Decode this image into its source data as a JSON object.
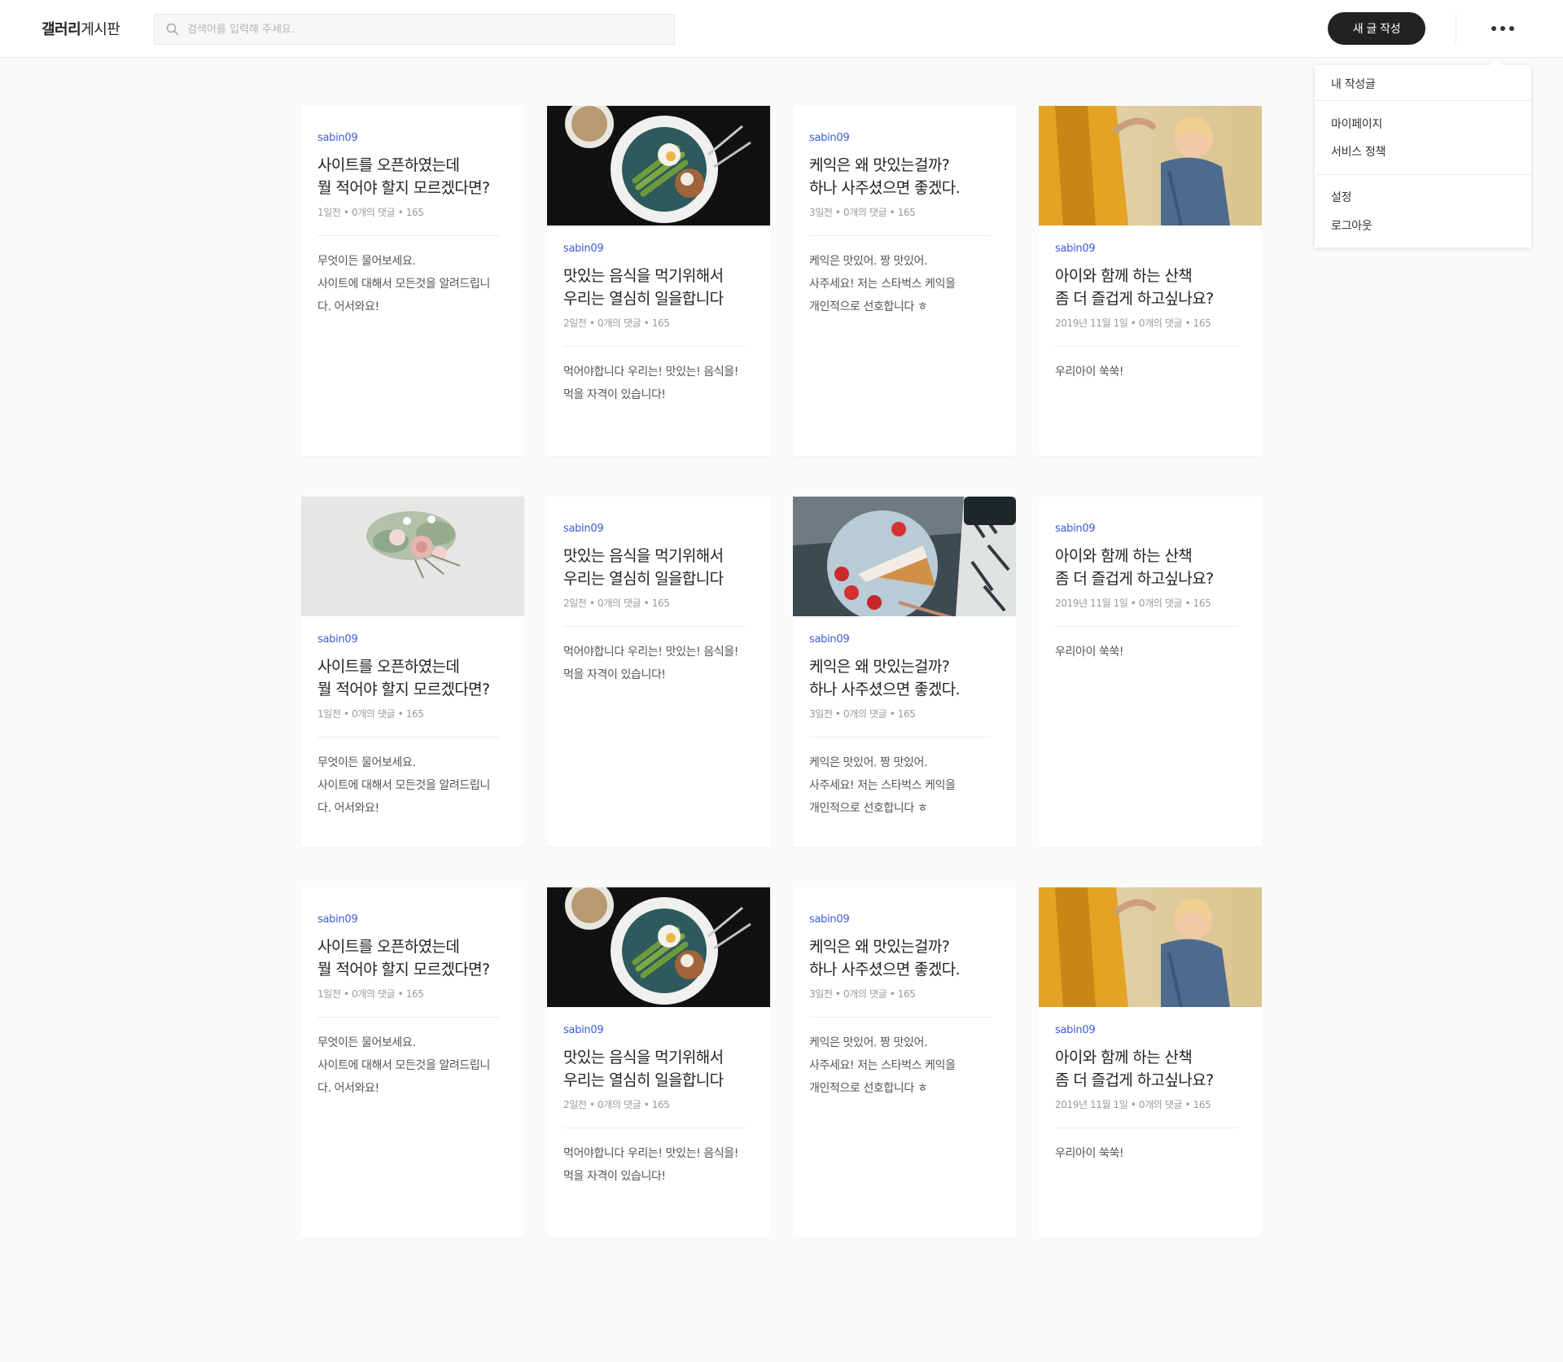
{
  "header": {
    "brand_bold": "갤러리",
    "brand_regular": "게시판",
    "search_placeholder": "검색어를 입력해 주세요.",
    "new_post_label": "새 글 작성"
  },
  "menu": {
    "my_posts": "내 작성글",
    "mypage": "마이페이지",
    "policy": "서비스 정책",
    "settings": "설정",
    "logout": "로그아웃"
  },
  "posts": {
    "startup": {
      "author": "sabin09",
      "title1": "사이트를 오픈하였는데",
      "title2": "뭘 적어야 할지 모르겠다면?",
      "meta": "1일전 • 0개의 댓글 • 165",
      "ex1": "무엇이든 물어보세요.",
      "ex2": "사이트에 대해서 모든것을 알려드립니",
      "ex3": "다. 어서와요!"
    },
    "food": {
      "author": "sabin09",
      "title1": "맛있는 음식을 먹기위해서",
      "title2": "우리는 열심히 일을합니다",
      "meta": "2일전 • 0개의 댓글 • 165",
      "ex1": "먹어야합니다 우리는! 맛있는! 음식을!",
      "ex2": "먹을 자격이 있습니다!",
      "ex3": ""
    },
    "cake": {
      "author": "sabin09",
      "title1": "케익은 왜 맛있는걸까?",
      "title2": "하나 사주셨으면 좋겠다.",
      "meta": "3일전 • 0개의 댓글 • 165",
      "ex1": "케익은 맛있어. 짱 맛있어.",
      "ex2": "사주세요! 저는 스타벅스 케익을",
      "ex3": "개인적으로 선호합니다 ㅎ"
    },
    "walk": {
      "author": "sabin09",
      "title1": "아이와 함께 하는 산책",
      "title2": "좀 더 즐겁게 하고싶나요?",
      "meta": "2019년 11월 1일 • 0개의 댓글 • 165",
      "ex1": "우리아이 쑥쑥!",
      "ex2": "",
      "ex3": ""
    }
  }
}
